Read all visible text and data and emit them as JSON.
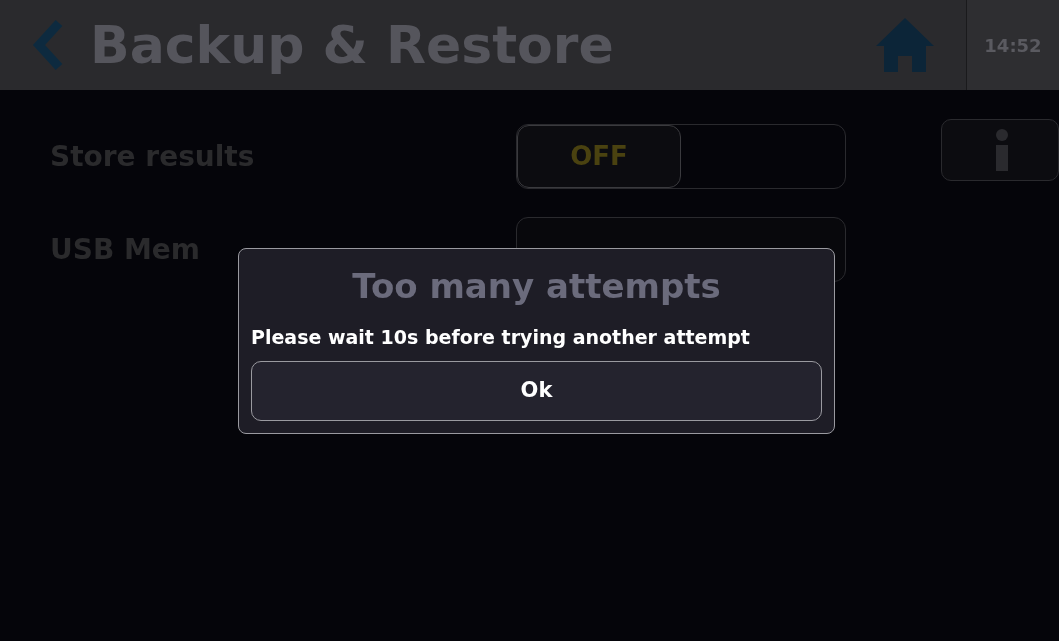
{
  "header": {
    "title": "Backup & Restore",
    "time": "14:52"
  },
  "settings": [
    {
      "kind": "toggle",
      "label": "Store results",
      "value": "OFF",
      "on": false
    },
    {
      "kind": "button",
      "label": "USB Mem"
    }
  ],
  "dialog": {
    "title": "Too many attempts",
    "message": "Please wait 10s before trying another attempt",
    "button": "Ok"
  }
}
